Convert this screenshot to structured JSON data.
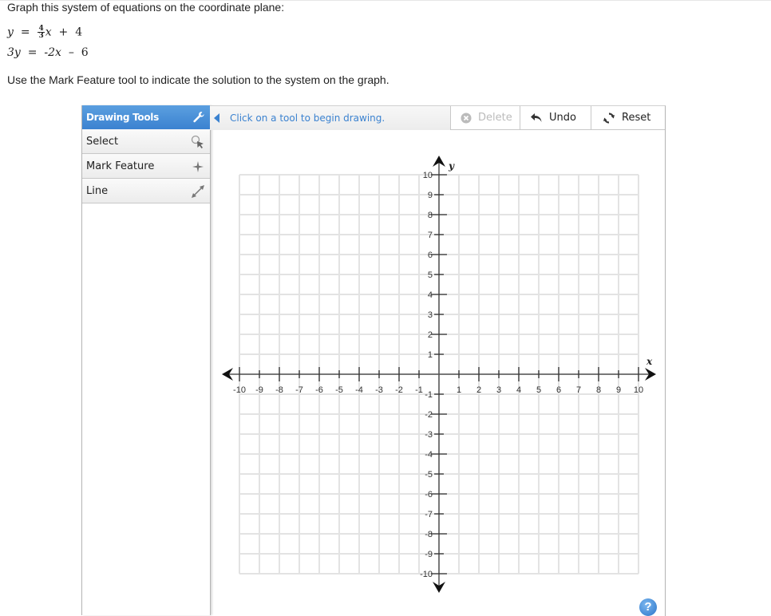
{
  "question": {
    "prompt": "Graph this system of equations on the coordinate plane:",
    "equation1": {
      "lhs": "y",
      "eq": "=",
      "coef_num": "4",
      "coef_den": "3",
      "var": "x",
      "op": "+",
      "const": "4"
    },
    "equation2": {
      "lhs": "3y",
      "eq": "=",
      "rhs_term": "-2x",
      "op": "–",
      "const": "6"
    },
    "instruction": "Use the Mark Feature tool to indicate the solution to the system on the graph."
  },
  "sidebar": {
    "header": "Drawing Tools",
    "header_icon": "wrench-icon",
    "items": [
      {
        "label": "Select",
        "icon": "select-pointer-icon"
      },
      {
        "label": "Mark Feature",
        "icon": "four-point-star-icon"
      },
      {
        "label": "Line",
        "icon": "double-arrow-line-icon"
      }
    ]
  },
  "toolbar": {
    "hint": "Click on a tool to begin drawing.",
    "delete_label": "Delete",
    "undo_label": "Undo",
    "reset_label": "Reset"
  },
  "graph": {
    "x_label": "x",
    "y_label": "y",
    "x_range": [
      -10,
      10
    ],
    "y_range": [
      -10,
      10
    ],
    "step": 1,
    "x_ticks": [
      "-10",
      "-9",
      "-8",
      "-7",
      "-6",
      "-5",
      "-4",
      "-3",
      "-2",
      "-1",
      "1",
      "2",
      "3",
      "4",
      "5",
      "6",
      "7",
      "8",
      "9",
      "10"
    ],
    "y_ticks": [
      "10",
      "9",
      "8",
      "7",
      "6",
      "5",
      "4",
      "3",
      "2",
      "1",
      "-1",
      "-2",
      "-3",
      "-4",
      "-5",
      "-6",
      "-7",
      "-8",
      "-9",
      "-10"
    ]
  },
  "help_label": "?",
  "colors": {
    "accent": "#3b82d0",
    "grid": "#e3e3e3",
    "axis": "#555555"
  }
}
